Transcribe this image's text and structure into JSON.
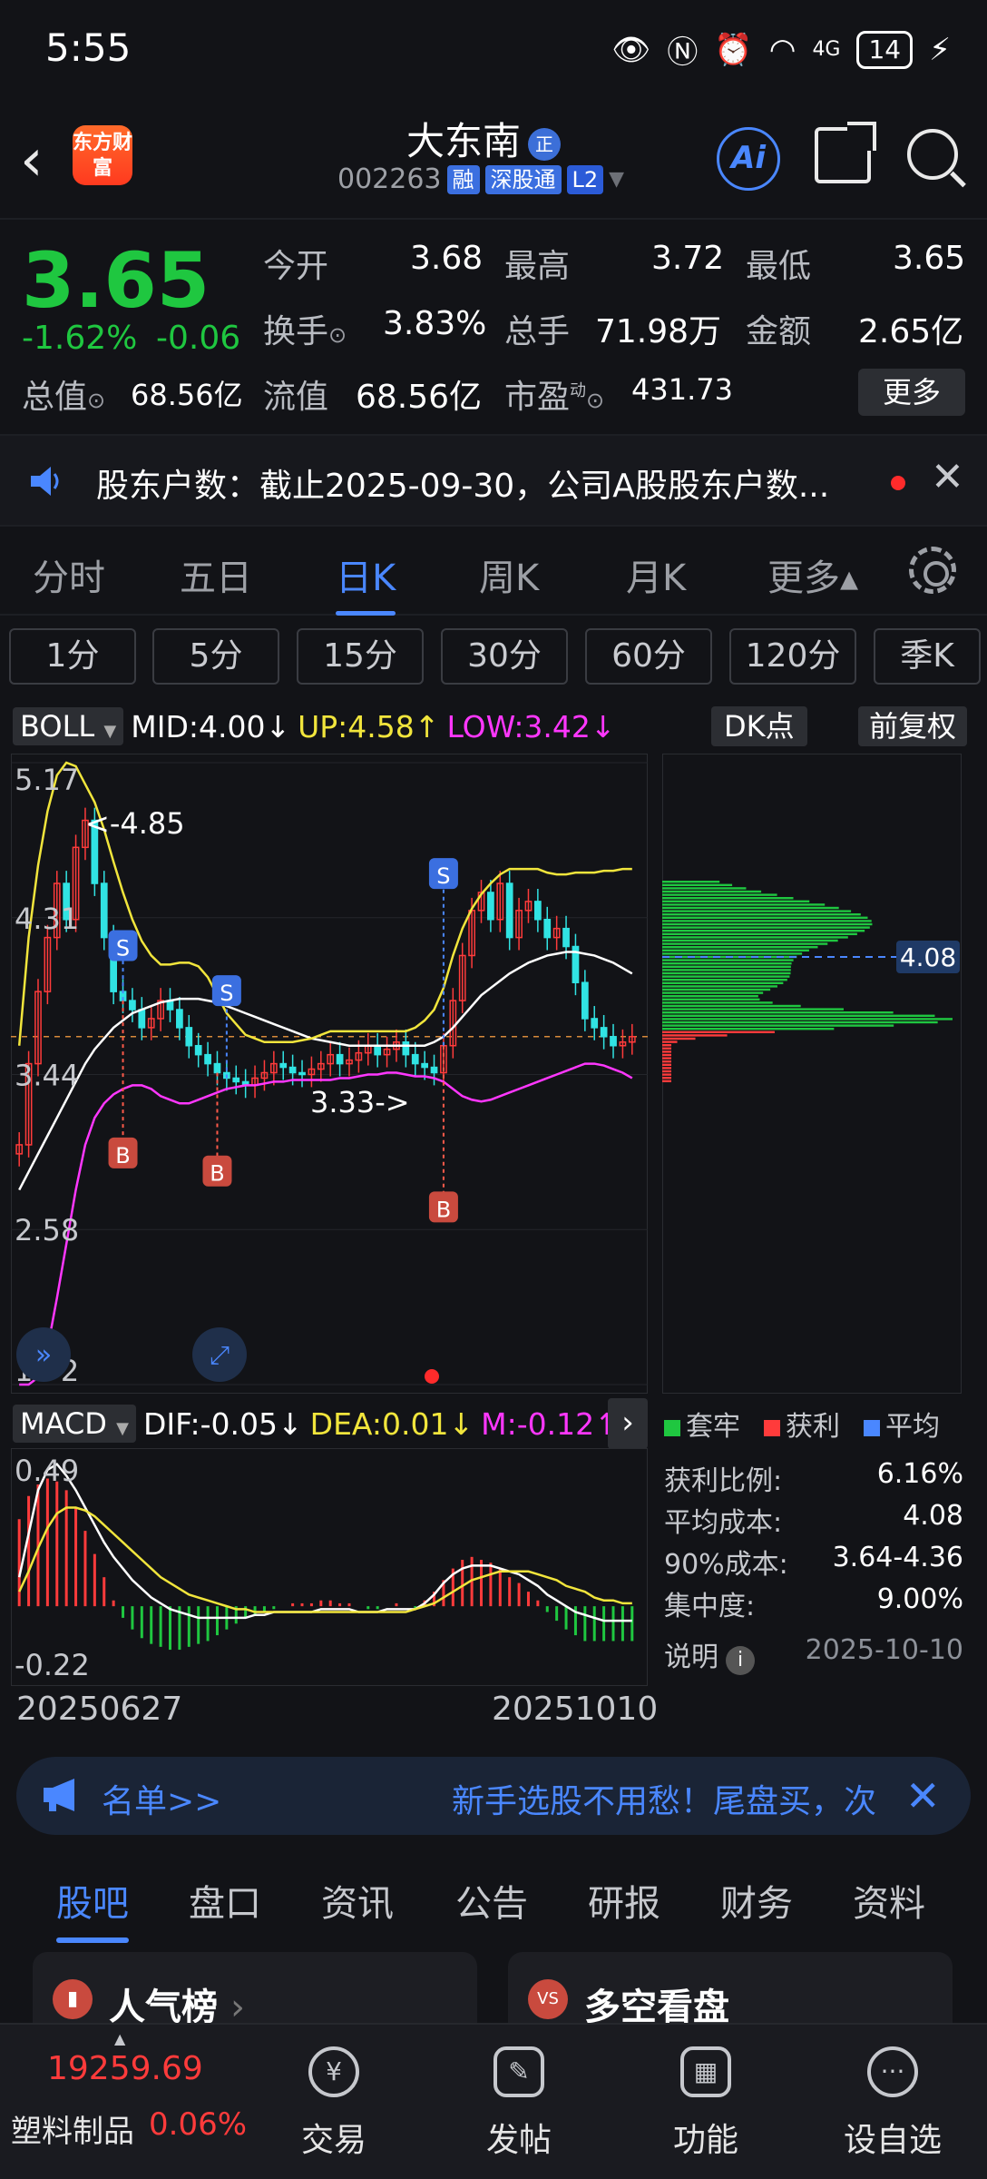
{
  "status": {
    "time": "5:55",
    "battery": "14",
    "signal": "4G"
  },
  "header": {
    "name": "大东南",
    "badge": "正",
    "code": "002263",
    "tags": [
      "融",
      "深股通",
      "L2"
    ],
    "logo": "东方财富",
    "ai_label": "Ai"
  },
  "quote": {
    "price": "3.65",
    "change_pct": "-1.62%",
    "change": "-0.06",
    "fields": [
      {
        "label": "今开",
        "value": "3.68",
        "color": "#1fc740"
      },
      {
        "label": "最高",
        "value": "3.72",
        "color": "#ff3b3b"
      },
      {
        "label": "最低",
        "value": "3.65",
        "color": "#1fc740"
      },
      {
        "label": "换手",
        "value": "3.83%",
        "color": "#ffffff"
      },
      {
        "label": "总手",
        "value": "71.98万",
        "color": "#ffffff"
      },
      {
        "label": "金额",
        "value": "2.65亿",
        "color": "#ffffff"
      },
      {
        "label": "总值",
        "value": "68.56亿",
        "color": "#ffffff"
      },
      {
        "label": "流值",
        "value": "68.56亿",
        "color": "#ffffff"
      },
      {
        "label": "市盈",
        "value": "431.73",
        "color": "#ffffff"
      }
    ],
    "pe_sup": "动",
    "more": "更多"
  },
  "notice": {
    "text": "股东户数：截止2025-09-30，公司A股股东户数..."
  },
  "periods": [
    "分时",
    "五日",
    "日K",
    "周K",
    "月K",
    "更多▴"
  ],
  "active_period": "日K",
  "intervals": [
    "1分",
    "5分",
    "15分",
    "30分",
    "60分",
    "120分",
    "季K"
  ],
  "boll": {
    "name": "BOLL",
    "mid": "MID:4.00↓",
    "up": "UP:4.58↑",
    "low": "LOW:3.42↓",
    "dk": "DK点",
    "fq": "前复权"
  },
  "macd": {
    "name": "MACD",
    "dif": "DIF:-0.05↓",
    "dea": "DEA:0.01↓",
    "m": "M:-0.12↑",
    "arrow": "›"
  },
  "dates": {
    "start": "20250627",
    "end": "20251010"
  },
  "chart_data": [
    {
      "type": "candlestick",
      "indicator": "BOLL",
      "ylim": [
        1.72,
        5.17
      ],
      "y_ticks": [
        "5.17",
        "4.31",
        "3.44",
        "2.58",
        "1.72"
      ],
      "annotations": [
        "<-4.85",
        "3.33->"
      ],
      "signals": [
        "S",
        "S",
        "S",
        "B",
        "B",
        "B"
      ],
      "current_price": 3.65,
      "close": [
        3.05,
        3.5,
        3.9,
        4.2,
        4.5,
        4.3,
        4.7,
        4.85,
        4.5,
        4.2,
        3.9,
        3.85,
        3.8,
        3.7,
        3.75,
        3.85,
        3.8,
        3.7,
        3.6,
        3.55,
        3.5,
        3.45,
        3.42,
        3.4,
        3.38,
        3.42,
        3.45,
        3.5,
        3.48,
        3.45,
        3.44,
        3.47,
        3.5,
        3.55,
        3.5,
        3.52,
        3.56,
        3.6,
        3.55,
        3.58,
        3.62,
        3.55,
        3.5,
        3.48,
        3.45,
        3.6,
        3.85,
        4.1,
        4.35,
        4.45,
        4.3,
        4.5,
        4.2,
        4.35,
        4.4,
        4.3,
        4.2,
        4.25,
        4.15,
        3.95,
        3.75,
        3.7,
        3.65,
        3.6,
        3.62,
        3.65
      ],
      "mid": [
        2.8,
        2.9,
        3.0,
        3.1,
        3.2,
        3.3,
        3.4,
        3.5,
        3.58,
        3.64,
        3.7,
        3.74,
        3.78,
        3.8,
        3.82,
        3.84,
        3.85,
        3.86,
        3.86,
        3.86,
        3.85,
        3.84,
        3.82,
        3.8,
        3.78,
        3.76,
        3.74,
        3.72,
        3.7,
        3.68,
        3.66,
        3.64,
        3.63,
        3.62,
        3.61,
        3.6,
        3.6,
        3.6,
        3.6,
        3.6,
        3.6,
        3.6,
        3.6,
        3.6,
        3.62,
        3.65,
        3.7,
        3.76,
        3.82,
        3.88,
        3.92,
        3.96,
        4.0,
        4.03,
        4.06,
        4.08,
        4.1,
        4.11,
        4.12,
        4.12,
        4.11,
        4.1,
        4.08,
        4.06,
        4.03,
        4.0
      ],
      "up": [
        3.6,
        4.2,
        4.6,
        4.9,
        5.1,
        5.17,
        5.15,
        5.05,
        4.95,
        4.8,
        4.62,
        4.45,
        4.3,
        4.18,
        4.1,
        4.05,
        4.05,
        4.06,
        4.06,
        4.04,
        3.98,
        3.88,
        3.78,
        3.72,
        3.66,
        3.64,
        3.62,
        3.62,
        3.62,
        3.62,
        3.63,
        3.64,
        3.66,
        3.68,
        3.68,
        3.68,
        3.68,
        3.68,
        3.68,
        3.68,
        3.68,
        3.68,
        3.7,
        3.74,
        3.8,
        3.92,
        4.1,
        4.25,
        4.36,
        4.44,
        4.5,
        4.55,
        4.58,
        4.58,
        4.58,
        4.58,
        4.56,
        4.55,
        4.55,
        4.56,
        4.56,
        4.56,
        4.57,
        4.57,
        4.58,
        4.58
      ],
      "low": [
        1.72,
        1.72,
        1.76,
        1.92,
        2.2,
        2.5,
        2.8,
        3.05,
        3.2,
        3.28,
        3.33,
        3.36,
        3.38,
        3.38,
        3.36,
        3.32,
        3.3,
        3.28,
        3.28,
        3.3,
        3.32,
        3.34,
        3.36,
        3.37,
        3.38,
        3.38,
        3.39,
        3.4,
        3.4,
        3.41,
        3.41,
        3.41,
        3.41,
        3.41,
        3.42,
        3.42,
        3.43,
        3.44,
        3.44,
        3.45,
        3.45,
        3.44,
        3.43,
        3.43,
        3.42,
        3.4,
        3.36,
        3.32,
        3.3,
        3.29,
        3.3,
        3.32,
        3.34,
        3.36,
        3.38,
        3.4,
        3.42,
        3.44,
        3.46,
        3.48,
        3.5,
        3.5,
        3.49,
        3.47,
        3.45,
        3.42
      ]
    },
    {
      "type": "bar",
      "indicator": "MACD",
      "ylim": [
        -0.22,
        0.49
      ],
      "y_ticks": [
        "0.49",
        "-0.22"
      ],
      "m": [
        0.3,
        0.38,
        0.42,
        0.44,
        0.43,
        0.4,
        0.34,
        0.26,
        0.18,
        0.1,
        0.02,
        -0.04,
        -0.08,
        -0.11,
        -0.13,
        -0.14,
        -0.15,
        -0.15,
        -0.14,
        -0.13,
        -0.12,
        -0.1,
        -0.08,
        -0.06,
        -0.04,
        -0.03,
        -0.02,
        -0.01,
        0.0,
        0.01,
        0.01,
        0.01,
        0.02,
        0.02,
        0.01,
        0.01,
        0.0,
        -0.01,
        -0.01,
        0.0,
        0.01,
        0.0,
        -0.01,
        0.02,
        0.05,
        0.09,
        0.13,
        0.16,
        0.17,
        0.16,
        0.15,
        0.13,
        0.1,
        0.08,
        0.05,
        0.02,
        -0.02,
        -0.05,
        -0.08,
        -0.1,
        -0.12,
        -0.12,
        -0.12,
        -0.12,
        -0.12,
        -0.12
      ],
      "dif": [
        0.1,
        0.25,
        0.4,
        0.47,
        0.49,
        0.45,
        0.4,
        0.34,
        0.28,
        0.22,
        0.17,
        0.13,
        0.09,
        0.06,
        0.03,
        0.01,
        -0.01,
        -0.02,
        -0.03,
        -0.04,
        -0.04,
        -0.04,
        -0.04,
        -0.04,
        -0.04,
        -0.03,
        -0.03,
        -0.02,
        -0.02,
        -0.02,
        -0.02,
        -0.02,
        -0.01,
        -0.01,
        -0.01,
        -0.01,
        -0.02,
        -0.02,
        -0.02,
        -0.01,
        -0.01,
        -0.01,
        -0.01,
        0.01,
        0.04,
        0.08,
        0.11,
        0.13,
        0.14,
        0.14,
        0.14,
        0.13,
        0.12,
        0.11,
        0.09,
        0.07,
        0.04,
        0.02,
        0.0,
        -0.02,
        -0.03,
        -0.04,
        -0.05,
        -0.05,
        -0.05,
        -0.05
      ],
      "dea": [
        0.05,
        0.12,
        0.2,
        0.27,
        0.32,
        0.34,
        0.34,
        0.33,
        0.31,
        0.28,
        0.25,
        0.22,
        0.19,
        0.16,
        0.13,
        0.1,
        0.08,
        0.06,
        0.04,
        0.03,
        0.02,
        0.01,
        0.0,
        -0.01,
        -0.01,
        -0.02,
        -0.02,
        -0.02,
        -0.02,
        -0.02,
        -0.02,
        -0.02,
        -0.02,
        -0.02,
        -0.02,
        -0.02,
        -0.02,
        -0.02,
        -0.02,
        -0.02,
        -0.02,
        -0.02,
        -0.01,
        0.0,
        0.01,
        0.03,
        0.05,
        0.07,
        0.09,
        0.1,
        0.11,
        0.12,
        0.12,
        0.12,
        0.12,
        0.11,
        0.1,
        0.09,
        0.07,
        0.06,
        0.05,
        0.03,
        0.02,
        0.02,
        0.01,
        0.01
      ]
    }
  ],
  "chip": {
    "avg_label": "4.08",
    "legend": [
      "套牢",
      "获利",
      "平均"
    ],
    "stats": [
      {
        "label": "获利比例:",
        "value": "6.16%"
      },
      {
        "label": "平均成本:",
        "value": "4.08"
      },
      {
        "label": "90%成本:",
        "value": "3.64-4.36"
      },
      {
        "label": "集中度:",
        "value": "9.00%"
      }
    ],
    "note": "说明",
    "date": "2025-10-10"
  },
  "promo": {
    "list": "名单>>",
    "text": "新手选股不用愁！尾盘买，次日卖"
  },
  "subtabs": [
    "股吧",
    "盘口",
    "资讯",
    "公告",
    "研报",
    "财务",
    "资料"
  ],
  "cards": [
    "人气榜",
    "多空看盘"
  ],
  "bottom": {
    "index_value": "19259.69",
    "index_name": "塑料制品",
    "index_change": "0.06%",
    "nav": [
      "交易",
      "发帖",
      "功能",
      "设自选"
    ]
  },
  "colors": {
    "up": "#ff3b3b",
    "down": "#1fc740",
    "accent": "#4a87ff",
    "boll_up": "#f1e53c",
    "boll_low": "#ff37ff"
  }
}
